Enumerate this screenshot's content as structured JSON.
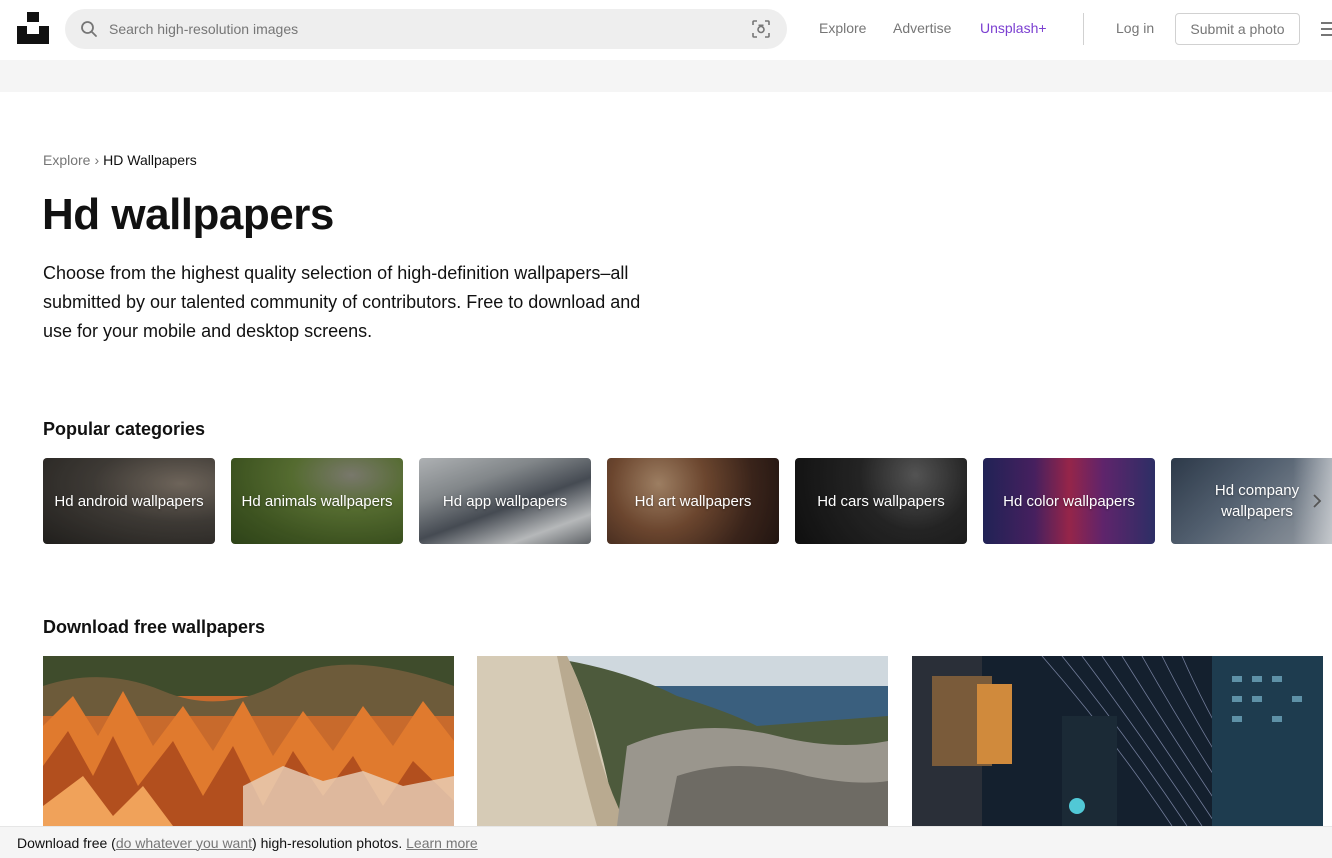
{
  "header": {
    "search_placeholder": "Search high-resolution images",
    "nav": {
      "explore": "Explore",
      "advertise": "Advertise",
      "unsplash_plus": "Unsplash+",
      "login": "Log in",
      "submit": "Submit a photo"
    },
    "icons": [
      "unsplash-logo",
      "search-icon",
      "visual-search-icon",
      "menu-icon"
    ]
  },
  "breadcrumb": {
    "root": "Explore",
    "separator": "›",
    "current": "HD Wallpapers"
  },
  "page": {
    "title": "Hd wallpapers",
    "description": "Choose from the highest quality selection of high-definition wallpapers–all submitted by our talented community of contributors. Free to download and use for your mobile and desktop screens."
  },
  "categories": {
    "heading": "Popular categories",
    "items": [
      {
        "label": "Hd android wallpapers"
      },
      {
        "label": "Hd animals wallpapers"
      },
      {
        "label": "Hd app wallpapers"
      },
      {
        "label": "Hd art wallpapers"
      },
      {
        "label": "Hd cars wallpapers"
      },
      {
        "label": "Hd color wallpapers"
      },
      {
        "label": "Hd company wallpapers"
      }
    ]
  },
  "downloads": {
    "heading": "Download free wallpapers"
  },
  "footer": {
    "prefix": "Download free (",
    "link1": "do whatever you want",
    "middle": ") high-resolution photos. ",
    "link2": "Learn more"
  },
  "colors": {
    "accent_plus": "#7b3fd1",
    "muted_text": "#767676",
    "search_bg": "#eeeeee"
  }
}
